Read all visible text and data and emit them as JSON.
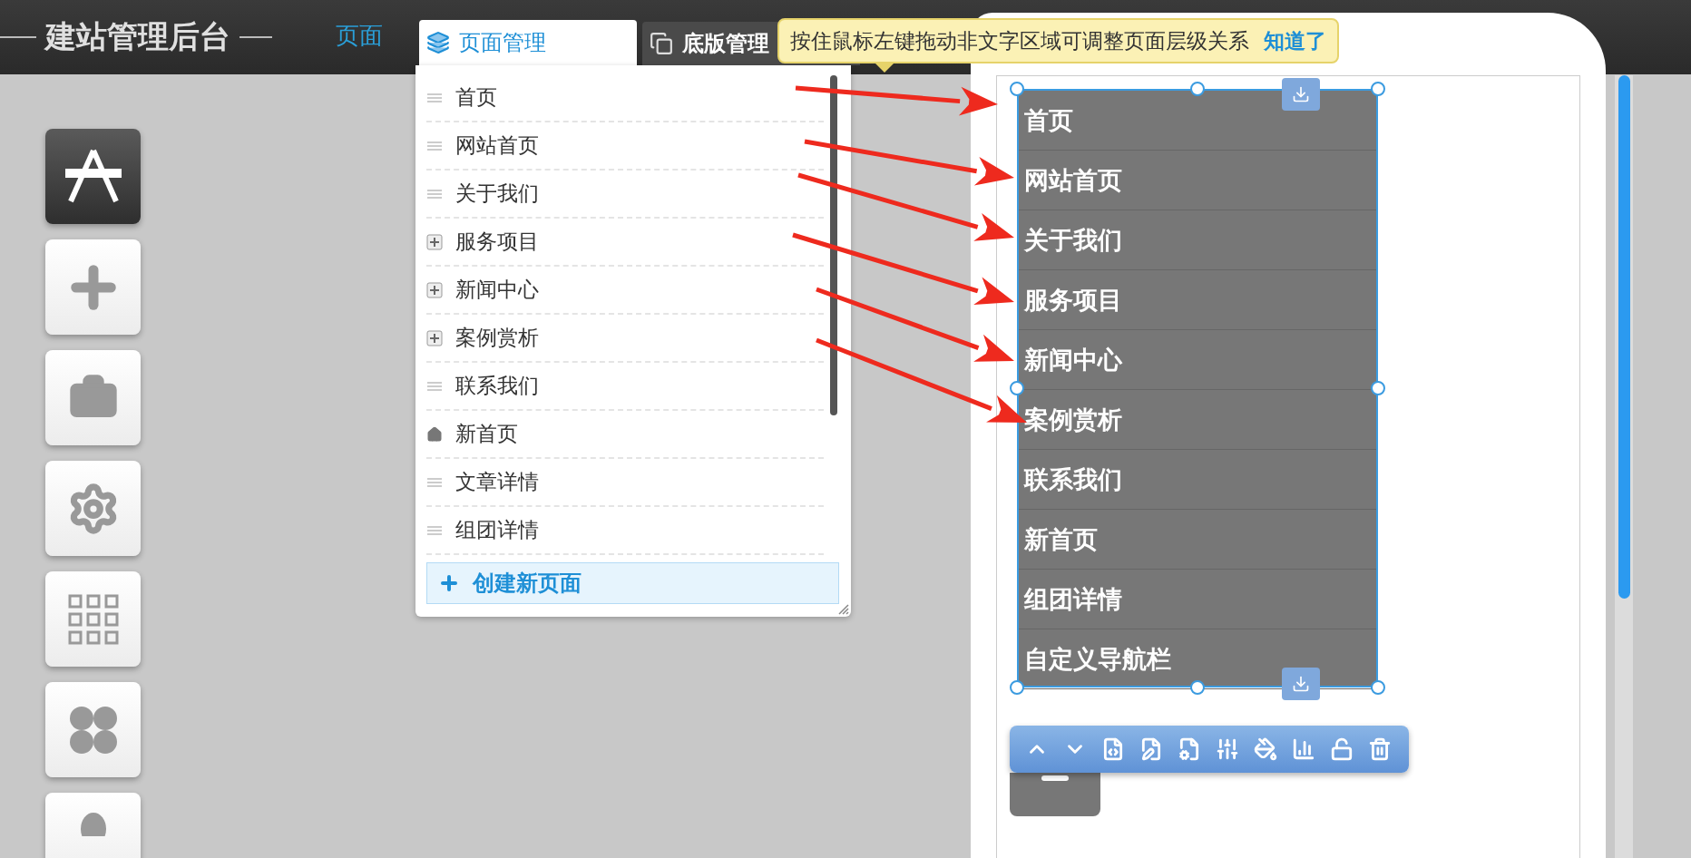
{
  "app_title": "建站管理后台",
  "nav_label": "页面",
  "tabs": [
    {
      "label": "页面管理",
      "selected": true
    },
    {
      "label": "底版管理",
      "selected": false
    }
  ],
  "tooltip": {
    "text": "按住鼠标左键拖动非文字区域可调整页面层级关系",
    "action": "知道了"
  },
  "page_list": {
    "items": [
      {
        "label": "首页",
        "kind": "page"
      },
      {
        "label": "网站首页",
        "kind": "page"
      },
      {
        "label": "关于我们",
        "kind": "page"
      },
      {
        "label": "服务项目",
        "kind": "group"
      },
      {
        "label": "新闻中心",
        "kind": "group"
      },
      {
        "label": "案例赏析",
        "kind": "group"
      },
      {
        "label": "联系我们",
        "kind": "page"
      },
      {
        "label": "新首页",
        "kind": "home"
      },
      {
        "label": "文章详情",
        "kind": "page"
      },
      {
        "label": "组团详情",
        "kind": "page"
      }
    ],
    "create_button": "创建新页面"
  },
  "preview": {
    "nav_items": [
      "首页",
      "网站首页",
      "关于我们",
      "服务项目",
      "新闻中心",
      "案例赏析",
      "联系我们",
      "新首页",
      "组团详情",
      "自定义导航栏"
    ]
  }
}
